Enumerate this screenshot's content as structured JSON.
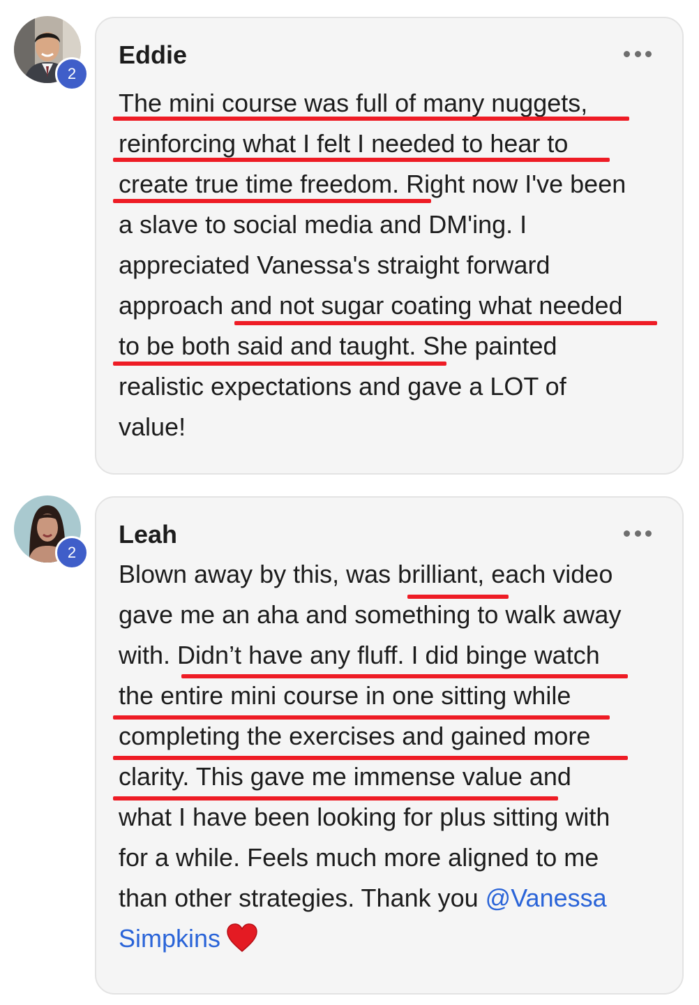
{
  "comments": [
    {
      "author": "Eddie",
      "badge": "2",
      "lines": [
        "The mini course was full of many nuggets,",
        "reinforcing what I felt I needed to hear to",
        "create true time freedom. Right now I've been",
        "a slave to social media and DM'ing. I",
        "appreciated Vanessa's straight forward",
        "approach and not sugar coating what needed",
        "to be both said and taught. She painted",
        "realistic expectations and gave a LOT of",
        "value!"
      ]
    },
    {
      "author": "Leah",
      "badge": "2",
      "lines": [
        "Blown away by this, was brilliant, each video",
        "gave me an aha and something to walk away",
        "with. Didn’t have any fluff. I did binge watch",
        "the entire mini course in one sitting while",
        "completing the exercises and gained more",
        "clarity. This gave me immense value and",
        "what I have been looking for plus sitting with",
        "for a while. Feels much more aligned to me",
        "than other strategies. Thank you"
      ],
      "mention_part1": "@Vanessa",
      "mention_part2": "Simpkins",
      "emoji": "heart-emoji"
    }
  ],
  "colors": {
    "bubble_bg": "#f5f5f5",
    "badge": "#3f5ec9",
    "underline": "#ee1c25",
    "mention": "#2a64d8"
  },
  "icons": [
    "more-options-icon",
    "heart-emoji-icon"
  ]
}
